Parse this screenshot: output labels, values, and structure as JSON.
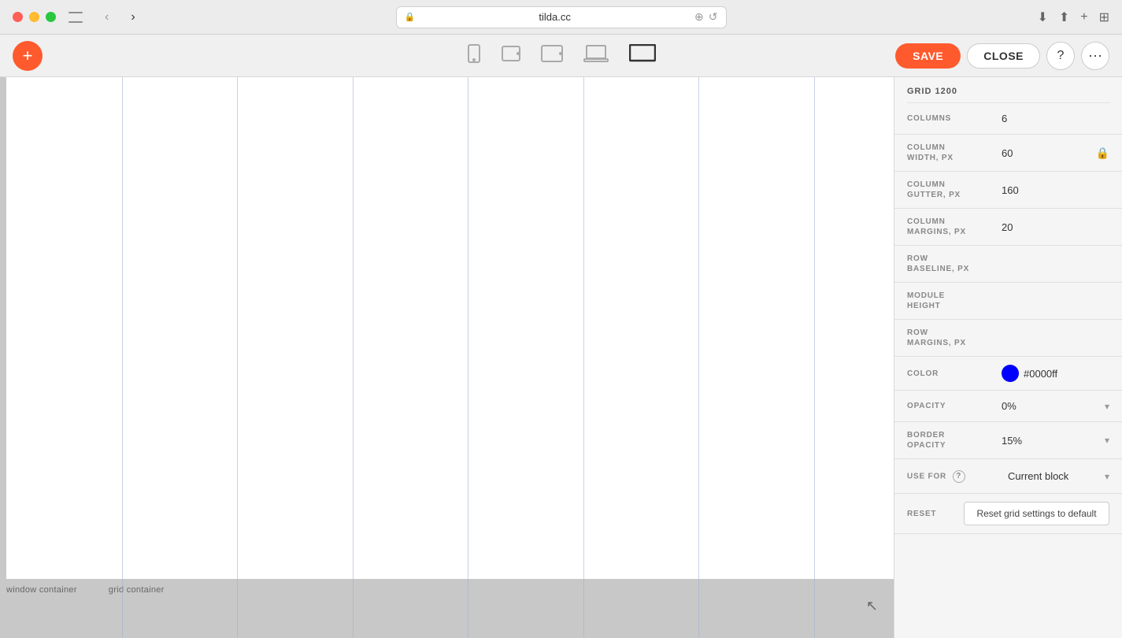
{
  "osbar": {
    "url": "tilda.cc",
    "lock_symbol": "🔒"
  },
  "toolbar": {
    "add_label": "+",
    "save_label": "SAVE",
    "close_label": "CLOSE",
    "help_label": "?",
    "more_label": "···"
  },
  "devices": [
    {
      "id": "mobile",
      "symbol": "📱",
      "label": "mobile"
    },
    {
      "id": "tablet-small",
      "symbol": "▭",
      "label": "tablet-small"
    },
    {
      "id": "tablet",
      "symbol": "▭",
      "label": "tablet"
    },
    {
      "id": "laptop",
      "symbol": "▭",
      "label": "laptop"
    },
    {
      "id": "desktop",
      "symbol": "▭",
      "label": "desktop",
      "active": true
    }
  ],
  "panel": {
    "grid_label": "GRID 1200",
    "columns_label": "COLUMNS",
    "columns_value": "6",
    "col_width_label": "COLUMN\nWIDTH, PX",
    "col_width_value": "60",
    "col_gutter_label": "COLUMN\nGUTTER, PX",
    "col_gutter_value": "160",
    "col_margins_label": "COLUMN\nMARGINS, PX",
    "col_margins_value": "20",
    "row_baseline_label": "ROW\nBASELINE, PX",
    "row_baseline_value": "",
    "module_height_label": "MODULE\nHEIGHT",
    "module_height_value": "",
    "row_margins_label": "ROW\nMARGINS, PX",
    "row_margins_value": "",
    "color_label": "COLOR",
    "color_value": "#0000ff",
    "color_hex": "#0000ff",
    "opacity_label": "OPACITY",
    "opacity_value": "0%",
    "border_opacity_label": "BORDER\nOPACITY",
    "border_opacity_value": "15%",
    "use_for_label": "USE FOR",
    "use_for_value": "Current block",
    "reset_label": "RESET",
    "reset_btn_label": "Reset grid settings to default"
  },
  "canvas": {
    "window_container_label": "window container",
    "grid_container_label": "grid container"
  }
}
